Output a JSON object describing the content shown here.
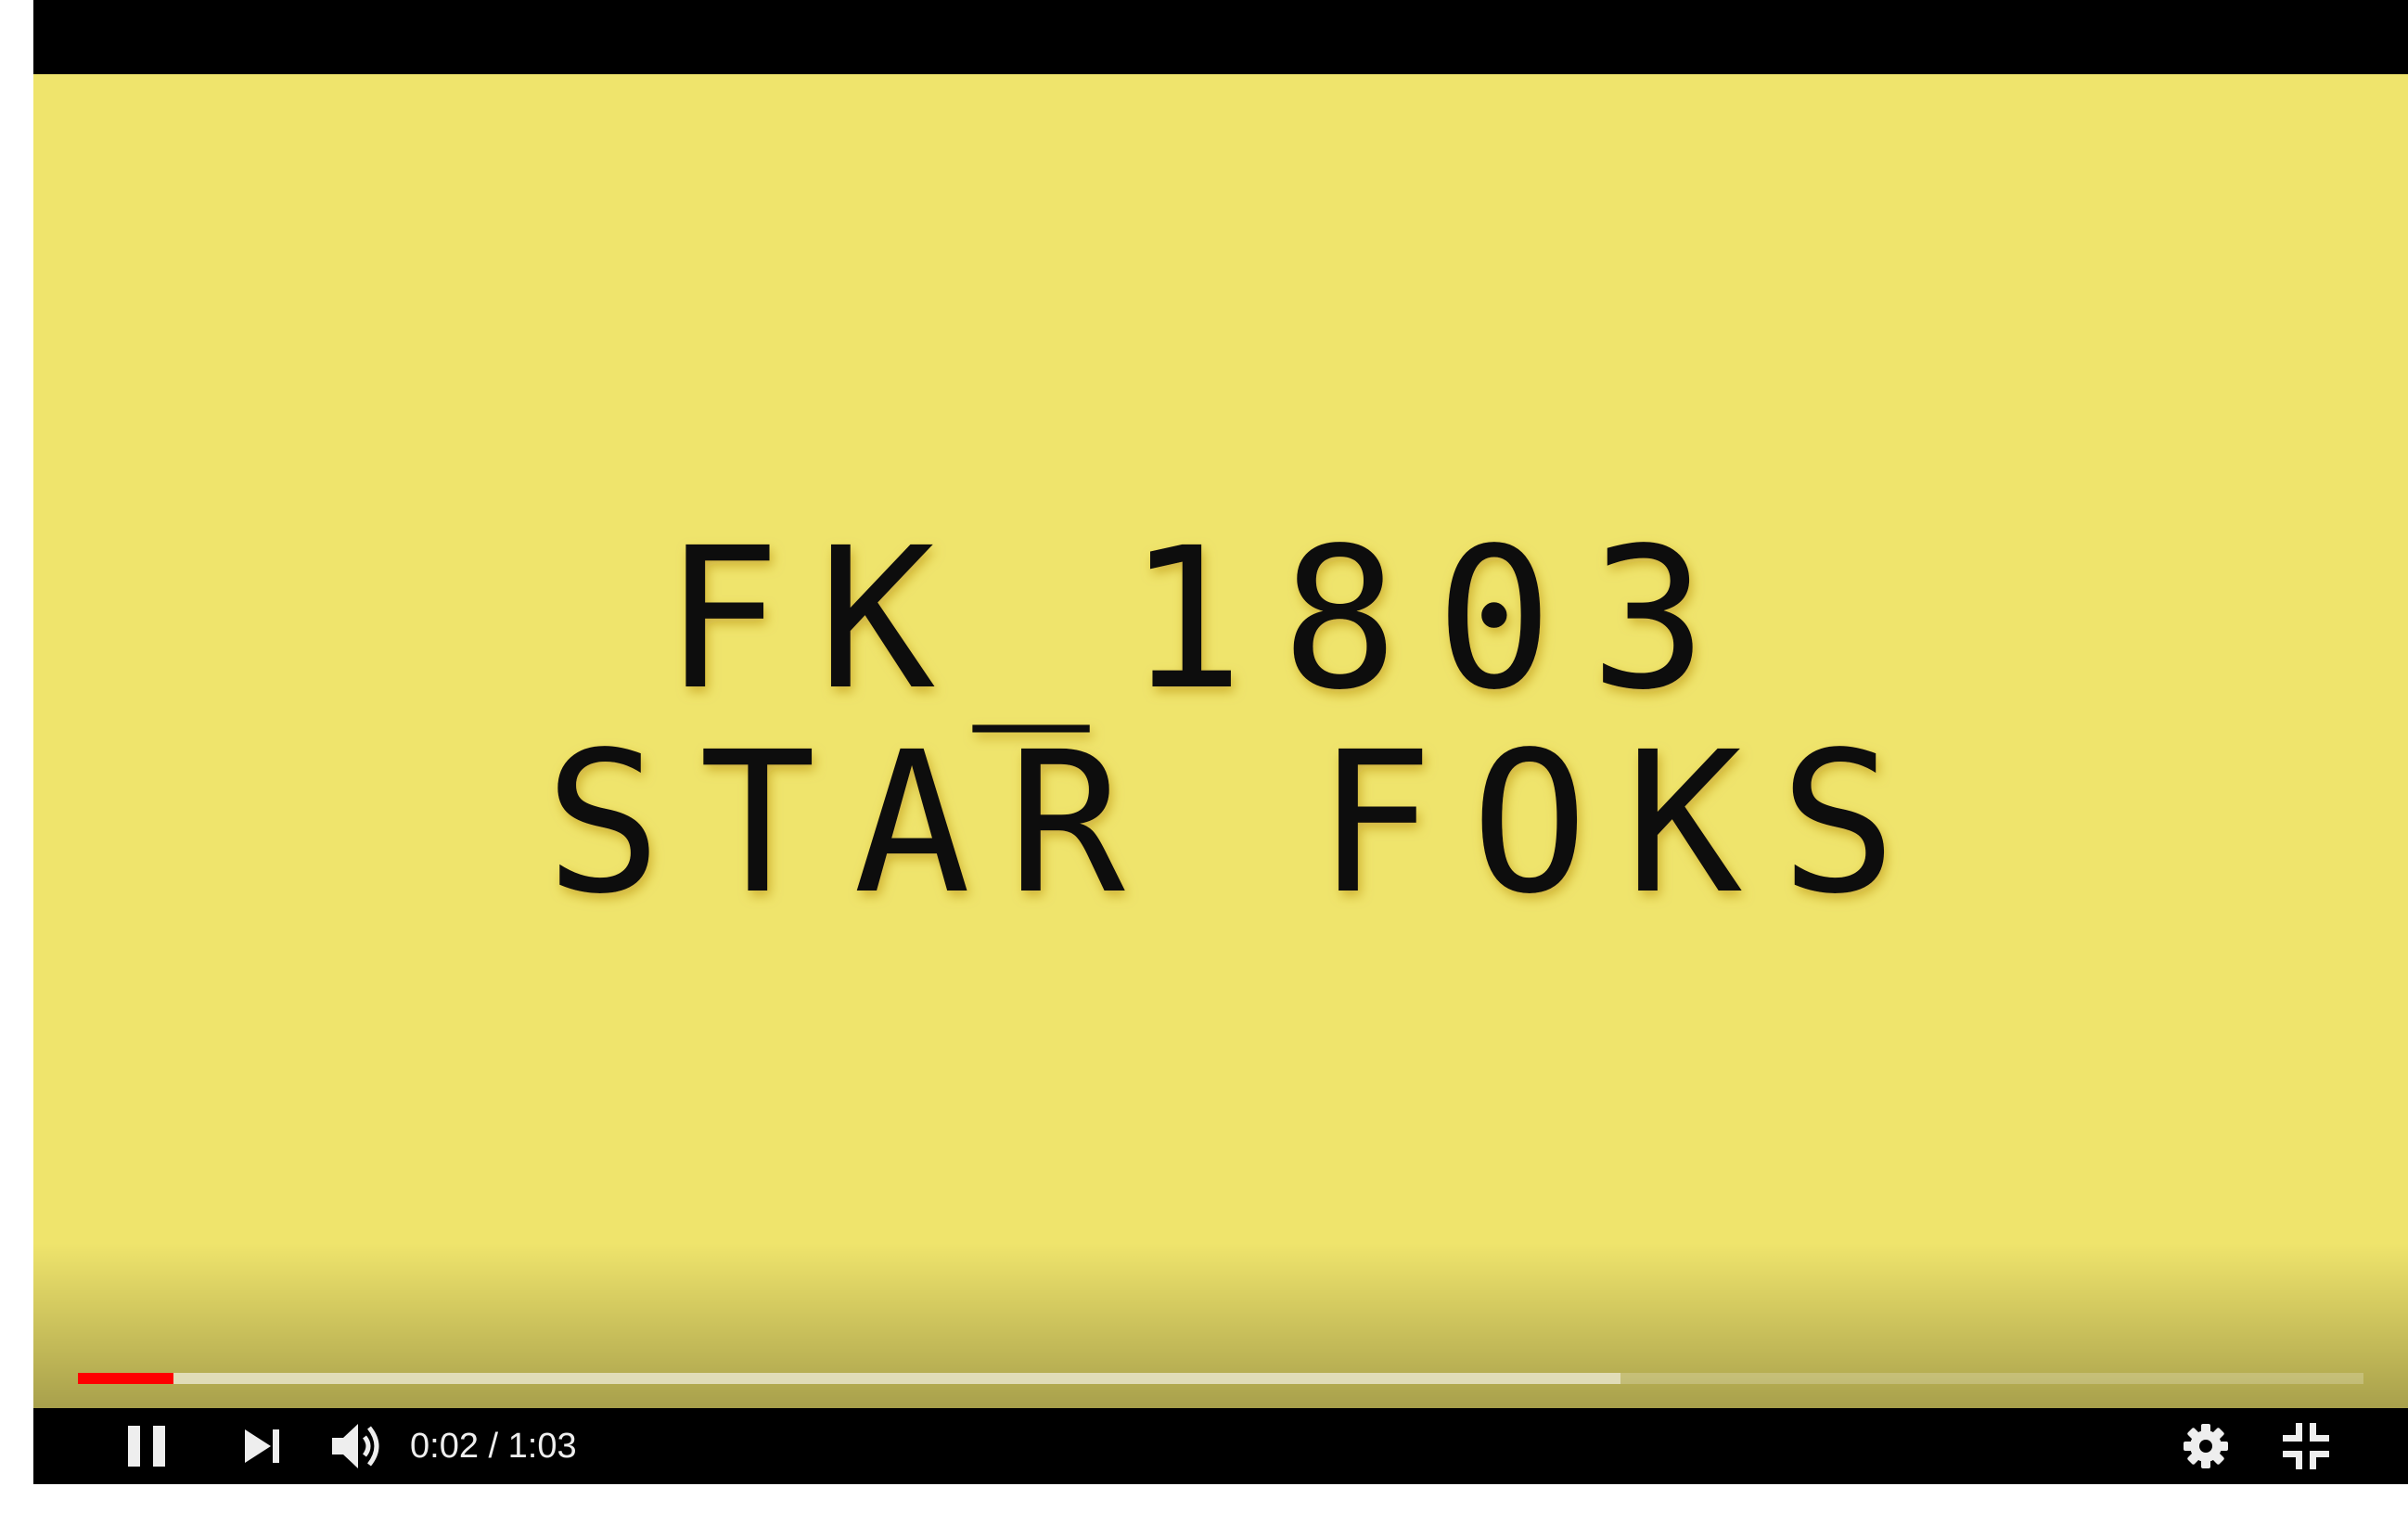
{
  "video": {
    "background_color": "#EFE46C",
    "title_line_1": "FK_1803",
    "title_line_2": "STAR FOKS",
    "title_color": "#111111"
  },
  "progress": {
    "played_fraction": 0.042,
    "buffered_fraction": 0.675,
    "played_color": "#FF0000"
  },
  "controls": {
    "play_pause_icon": "pause-icon",
    "next_icon": "skip-next-icon",
    "volume_icon": "volume-high-icon",
    "current_time": "0:02",
    "duration": "1:03",
    "time_separator": " / ",
    "settings_icon": "gear-icon",
    "fullscreen_icon": "fullscreen-exit-icon"
  }
}
